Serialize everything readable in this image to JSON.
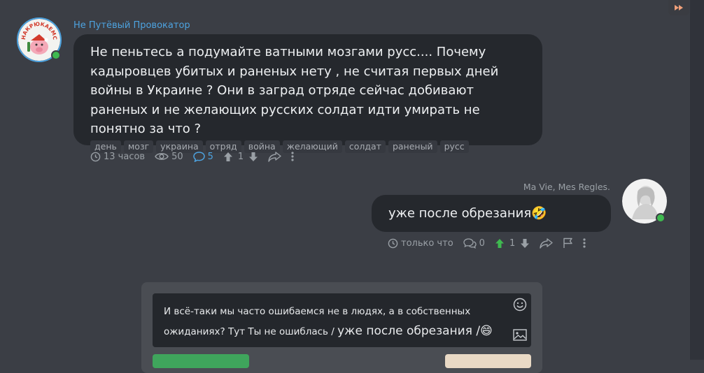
{
  "message1": {
    "author": "Не Путёвый Провокатор",
    "avatar_caption": "НАКРЮКАЕМСЯ",
    "text": "Не пеньтесь а подумайте ватными мозгами русс.... Почему кадыровцев убитых и раненых нету , не считая первых дней войны в Украине ? Они в заград отряде сейчас добивают раненых и не желающих русских солдат идти умирать не понятно за что ?",
    "tags": [
      "день",
      "мозг",
      "украина",
      "отряд",
      "война",
      "желающий",
      "солдат",
      "раненый",
      "русс"
    ],
    "time": "13 часов",
    "views": "50",
    "comments": "5",
    "rating": "1"
  },
  "message2": {
    "author": "Ma Vie, Mes Regles.",
    "text": "уже после обрезания🤣",
    "time": "только что",
    "comments": "0",
    "rating": "1"
  },
  "composer": {
    "text_main": "И всё-таки мы часто ошибаемся не в людях, а в собственных ожиданиях? Тут Ты не ошиблась / ",
    "text_quote": "уже после обрезания /",
    "text_emoji": "😄"
  },
  "colors": {
    "accent": "#4da3e0",
    "background": "#3b3e45",
    "bubble": "#25282d",
    "online": "#3fb950",
    "upvote_active": "#3fb950",
    "submit": "#3fa55c"
  },
  "icons": {
    "fast_forward": "fast-forward-icon",
    "clock": "clock-icon",
    "eye": "eye-icon",
    "comment": "comment-icon",
    "arrow_up": "arrow-up-icon",
    "arrow_down": "arrow-down-icon",
    "share": "share-icon",
    "more": "more-icon",
    "flag": "flag-icon",
    "smile": "smile-icon",
    "image": "image-icon"
  }
}
